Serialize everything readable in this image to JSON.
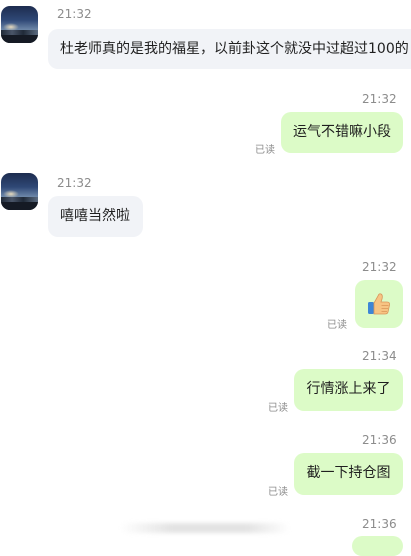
{
  "messages": [
    {
      "time": "21:32",
      "text": "杜老师真的是我的福星，以前卦这个就没中过超过100的"
    },
    {
      "time": "21:32",
      "text": "运气不错嘛小段",
      "status": "已读"
    },
    {
      "time": "21:32",
      "text": "嘻嘻当然啦"
    },
    {
      "time": "21:32",
      "emoji": "thumbs-up-icon",
      "status": "已读"
    },
    {
      "time": "21:34",
      "text": "行情涨上来了",
      "status": "已读"
    },
    {
      "time": "21:36",
      "text": "截一下持仓图",
      "status": "已读"
    },
    {
      "time": "21:36"
    }
  ],
  "colors": {
    "incoming_bubble": "#f1f3f7",
    "outgoing_bubble": "#dcfbc7",
    "thumb": "#f7c483",
    "cuff": "#3e86d6"
  }
}
